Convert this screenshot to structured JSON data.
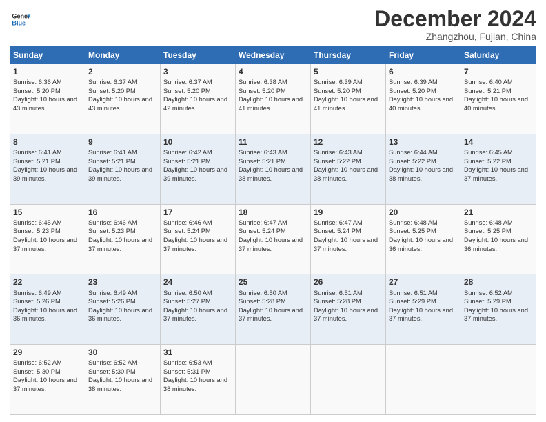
{
  "header": {
    "logo_line1": "General",
    "logo_line2": "Blue",
    "month": "December 2024",
    "location": "Zhangzhou, Fujian, China"
  },
  "days_of_week": [
    "Sunday",
    "Monday",
    "Tuesday",
    "Wednesday",
    "Thursday",
    "Friday",
    "Saturday"
  ],
  "weeks": [
    [
      {
        "day": "1",
        "sunrise": "Sunrise: 6:36 AM",
        "sunset": "Sunset: 5:20 PM",
        "daylight": "Daylight: 10 hours and 43 minutes."
      },
      {
        "day": "2",
        "sunrise": "Sunrise: 6:37 AM",
        "sunset": "Sunset: 5:20 PM",
        "daylight": "Daylight: 10 hours and 43 minutes."
      },
      {
        "day": "3",
        "sunrise": "Sunrise: 6:37 AM",
        "sunset": "Sunset: 5:20 PM",
        "daylight": "Daylight: 10 hours and 42 minutes."
      },
      {
        "day": "4",
        "sunrise": "Sunrise: 6:38 AM",
        "sunset": "Sunset: 5:20 PM",
        "daylight": "Daylight: 10 hours and 41 minutes."
      },
      {
        "day": "5",
        "sunrise": "Sunrise: 6:39 AM",
        "sunset": "Sunset: 5:20 PM",
        "daylight": "Daylight: 10 hours and 41 minutes."
      },
      {
        "day": "6",
        "sunrise": "Sunrise: 6:39 AM",
        "sunset": "Sunset: 5:20 PM",
        "daylight": "Daylight: 10 hours and 40 minutes."
      },
      {
        "day": "7",
        "sunrise": "Sunrise: 6:40 AM",
        "sunset": "Sunset: 5:21 PM",
        "daylight": "Daylight: 10 hours and 40 minutes."
      }
    ],
    [
      {
        "day": "8",
        "sunrise": "Sunrise: 6:41 AM",
        "sunset": "Sunset: 5:21 PM",
        "daylight": "Daylight: 10 hours and 39 minutes."
      },
      {
        "day": "9",
        "sunrise": "Sunrise: 6:41 AM",
        "sunset": "Sunset: 5:21 PM",
        "daylight": "Daylight: 10 hours and 39 minutes."
      },
      {
        "day": "10",
        "sunrise": "Sunrise: 6:42 AM",
        "sunset": "Sunset: 5:21 PM",
        "daylight": "Daylight: 10 hours and 39 minutes."
      },
      {
        "day": "11",
        "sunrise": "Sunrise: 6:43 AM",
        "sunset": "Sunset: 5:21 PM",
        "daylight": "Daylight: 10 hours and 38 minutes."
      },
      {
        "day": "12",
        "sunrise": "Sunrise: 6:43 AM",
        "sunset": "Sunset: 5:22 PM",
        "daylight": "Daylight: 10 hours and 38 minutes."
      },
      {
        "day": "13",
        "sunrise": "Sunrise: 6:44 AM",
        "sunset": "Sunset: 5:22 PM",
        "daylight": "Daylight: 10 hours and 38 minutes."
      },
      {
        "day": "14",
        "sunrise": "Sunrise: 6:45 AM",
        "sunset": "Sunset: 5:22 PM",
        "daylight": "Daylight: 10 hours and 37 minutes."
      }
    ],
    [
      {
        "day": "15",
        "sunrise": "Sunrise: 6:45 AM",
        "sunset": "Sunset: 5:23 PM",
        "daylight": "Daylight: 10 hours and 37 minutes."
      },
      {
        "day": "16",
        "sunrise": "Sunrise: 6:46 AM",
        "sunset": "Sunset: 5:23 PM",
        "daylight": "Daylight: 10 hours and 37 minutes."
      },
      {
        "day": "17",
        "sunrise": "Sunrise: 6:46 AM",
        "sunset": "Sunset: 5:24 PM",
        "daylight": "Daylight: 10 hours and 37 minutes."
      },
      {
        "day": "18",
        "sunrise": "Sunrise: 6:47 AM",
        "sunset": "Sunset: 5:24 PM",
        "daylight": "Daylight: 10 hours and 37 minutes."
      },
      {
        "day": "19",
        "sunrise": "Sunrise: 6:47 AM",
        "sunset": "Sunset: 5:24 PM",
        "daylight": "Daylight: 10 hours and 37 minutes."
      },
      {
        "day": "20",
        "sunrise": "Sunrise: 6:48 AM",
        "sunset": "Sunset: 5:25 PM",
        "daylight": "Daylight: 10 hours and 36 minutes."
      },
      {
        "day": "21",
        "sunrise": "Sunrise: 6:48 AM",
        "sunset": "Sunset: 5:25 PM",
        "daylight": "Daylight: 10 hours and 36 minutes."
      }
    ],
    [
      {
        "day": "22",
        "sunrise": "Sunrise: 6:49 AM",
        "sunset": "Sunset: 5:26 PM",
        "daylight": "Daylight: 10 hours and 36 minutes."
      },
      {
        "day": "23",
        "sunrise": "Sunrise: 6:49 AM",
        "sunset": "Sunset: 5:26 PM",
        "daylight": "Daylight: 10 hours and 36 minutes."
      },
      {
        "day": "24",
        "sunrise": "Sunrise: 6:50 AM",
        "sunset": "Sunset: 5:27 PM",
        "daylight": "Daylight: 10 hours and 37 minutes."
      },
      {
        "day": "25",
        "sunrise": "Sunrise: 6:50 AM",
        "sunset": "Sunset: 5:28 PM",
        "daylight": "Daylight: 10 hours and 37 minutes."
      },
      {
        "day": "26",
        "sunrise": "Sunrise: 6:51 AM",
        "sunset": "Sunset: 5:28 PM",
        "daylight": "Daylight: 10 hours and 37 minutes."
      },
      {
        "day": "27",
        "sunrise": "Sunrise: 6:51 AM",
        "sunset": "Sunset: 5:29 PM",
        "daylight": "Daylight: 10 hours and 37 minutes."
      },
      {
        "day": "28",
        "sunrise": "Sunrise: 6:52 AM",
        "sunset": "Sunset: 5:29 PM",
        "daylight": "Daylight: 10 hours and 37 minutes."
      }
    ],
    [
      {
        "day": "29",
        "sunrise": "Sunrise: 6:52 AM",
        "sunset": "Sunset: 5:30 PM",
        "daylight": "Daylight: 10 hours and 37 minutes."
      },
      {
        "day": "30",
        "sunrise": "Sunrise: 6:52 AM",
        "sunset": "Sunset: 5:30 PM",
        "daylight": "Daylight: 10 hours and 38 minutes."
      },
      {
        "day": "31",
        "sunrise": "Sunrise: 6:53 AM",
        "sunset": "Sunset: 5:31 PM",
        "daylight": "Daylight: 10 hours and 38 minutes."
      },
      null,
      null,
      null,
      null
    ]
  ]
}
